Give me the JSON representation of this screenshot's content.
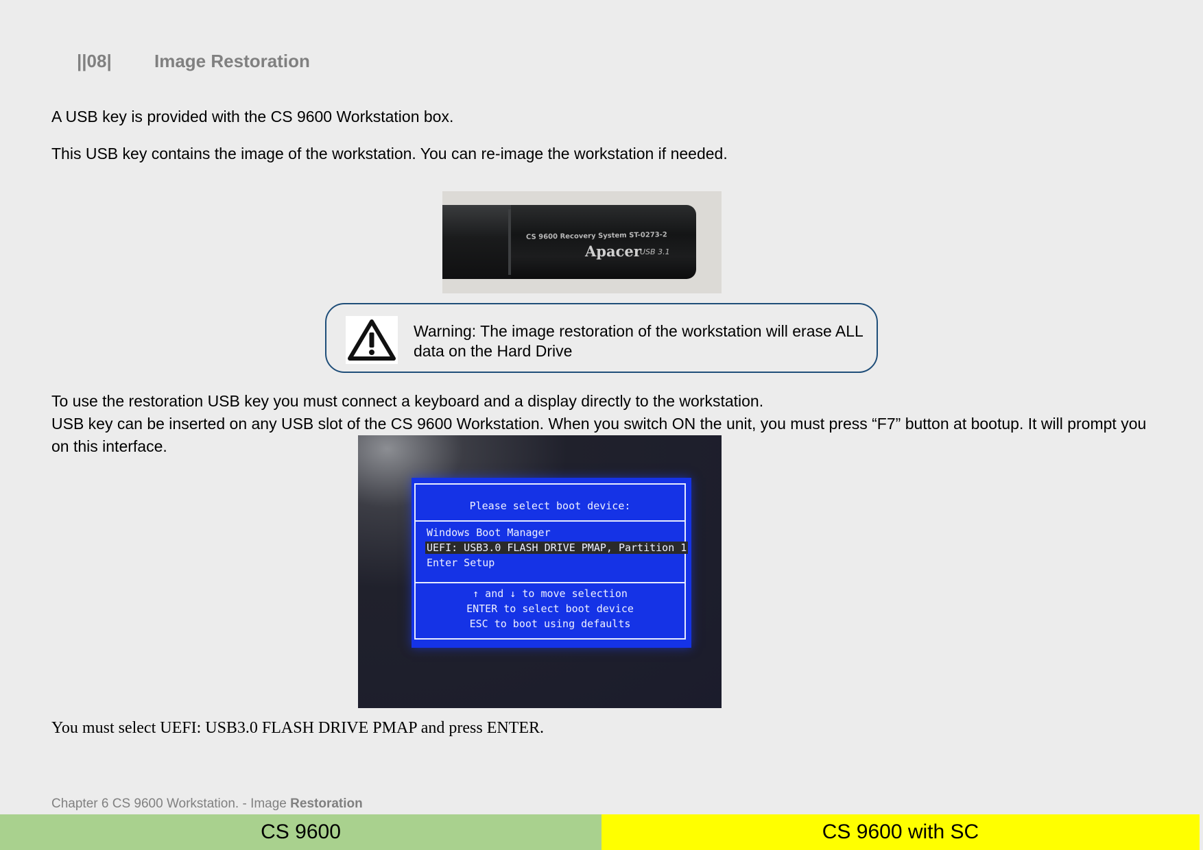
{
  "header": {
    "section_number": "||08|",
    "section_title": "Image Restoration"
  },
  "body": {
    "para1": "A USB key is provided with the CS 9600 Workstation box.",
    "para2": "This USB key contains the image of the workstation. You can re-image the workstation if needed.",
    "para3": "To use the restoration USB key you must connect a keyboard and a display directly to the workstation.",
    "para4": "USB key can be inserted on any USB slot of the CS 9600 Workstation. When you switch ON the unit, you must press “F7” button at bootup. It will prompt you on this interface.",
    "final_note": "You must select UEFI: USB3.0 FLASH DRIVE PMAP and press ENTER."
  },
  "usb_photo": {
    "label": "CS 9600 Recovery System ST-0273-2",
    "brand": "Apacer",
    "version": "USB 3.1"
  },
  "warning": {
    "icon": "warning-triangle-icon",
    "text": "Warning: The image restoration of the workstation will erase ALL data on the Hard Drive"
  },
  "bios": {
    "title": "Please select boot device:",
    "options": [
      "Windows Boot Manager",
      "UEFI: USB3.0 FLASH DRIVE PMAP, Partition 1",
      "Enter Setup"
    ],
    "selected_index": 1,
    "help": [
      "↑ and ↓ to move selection",
      "ENTER to select boot device",
      "ESC to boot using defaults"
    ]
  },
  "footer": {
    "chapter": "Chapter 6 CS 9600 Workstation.",
    "separator": " - Image ",
    "section_bold": "Restoration",
    "band_left": "CS 9600",
    "band_left_color": "#a9d18e",
    "band_right": "CS 9600 with SC",
    "band_right_color": "#ffff00"
  }
}
